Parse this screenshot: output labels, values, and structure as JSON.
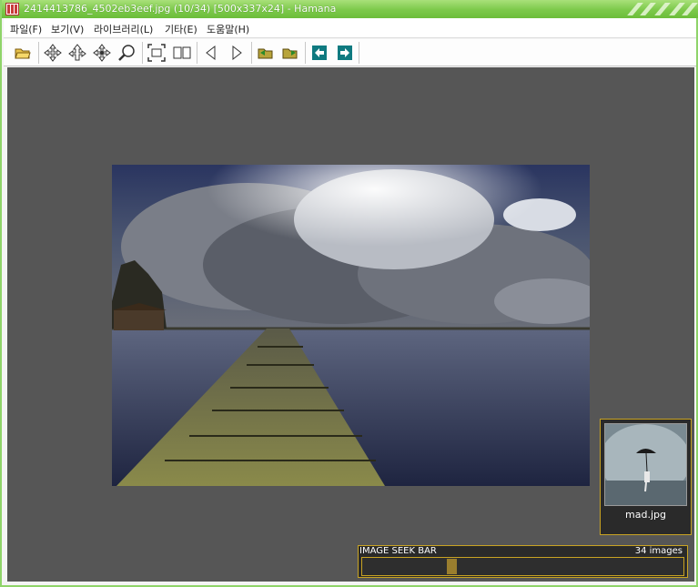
{
  "window": {
    "title": "2414413786_4502eb3eef.jpg  (10/34)  [500x337x24]  - Hamana"
  },
  "menu": {
    "items": [
      {
        "label": "파일(F)"
      },
      {
        "label": "보기(V)"
      },
      {
        "label": "라이브러리(L)"
      },
      {
        "label": "기타(E)"
      },
      {
        "label": "도움말(H)"
      }
    ]
  },
  "toolbar": {
    "icons": [
      "open-folder-icon",
      "move-icon",
      "rotate-icon",
      "pan-icon",
      "zoom-icon",
      "fit-screen-icon",
      "dual-page-icon",
      "prev-icon",
      "next-icon",
      "prev-folder-icon",
      "next-folder-icon",
      "prev-image-icon",
      "next-image-icon"
    ]
  },
  "thumbnail": {
    "label": "mad.jpg"
  },
  "seekbar": {
    "title": "IMAGE SEEK BAR",
    "count": "34 images",
    "position": 10,
    "total": 34
  },
  "colors": {
    "titlebar": "#7cc94a",
    "viewport": "#565656",
    "panel_border": "#c8a323",
    "arrow_teal": "#0f7a80"
  }
}
